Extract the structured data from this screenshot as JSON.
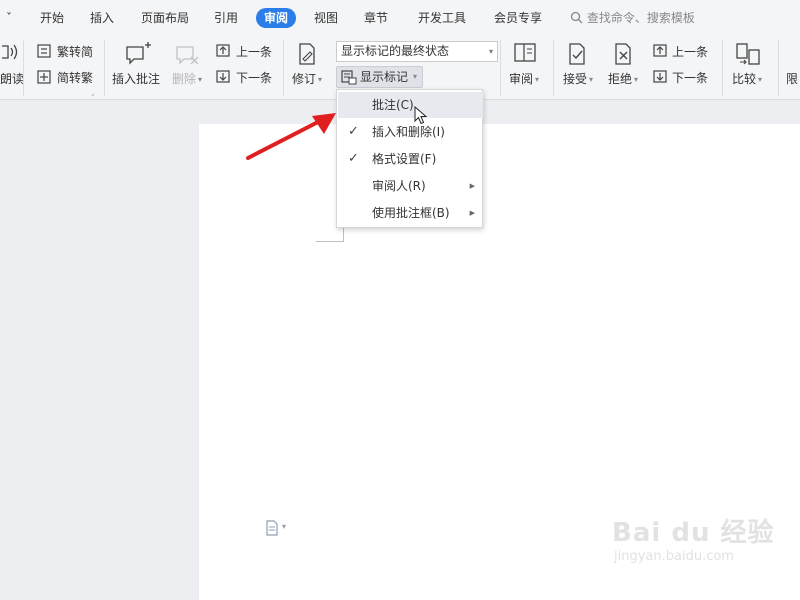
{
  "tabs": {
    "more_glyph": "ˇ",
    "items": [
      "开始",
      "插入",
      "页面布局",
      "引用",
      "审阅",
      "视图",
      "章节",
      "开发工具",
      "会员专享"
    ],
    "search_placeholder": "查找命令、搜索模板"
  },
  "ribbon": {
    "read_label": "朗读",
    "trad_to_simp": "繁转简",
    "simp_to_trad": "简转繁",
    "insert_comment": "插入批注",
    "delete": "删除",
    "prev_item": "上一条",
    "next_item": "下一条",
    "track_changes": "修订",
    "markup_combo": "显示标记的最终状态",
    "show_markup": "显示标记",
    "review": "审阅",
    "accept": "接受",
    "reject": "拒绝",
    "prev_change": "上一条",
    "next_change": "下一条",
    "compare": "比较",
    "restrict": "限"
  },
  "menu": {
    "items": [
      {
        "label": "批注(C)",
        "checked": false,
        "submenu": false,
        "highlighted": true
      },
      {
        "label": "插入和删除(I)",
        "checked": true,
        "submenu": false,
        "highlighted": false
      },
      {
        "label": "格式设置(F)",
        "checked": true,
        "submenu": false,
        "highlighted": false
      },
      {
        "label": "审阅人(R)",
        "checked": false,
        "submenu": true,
        "highlighted": false
      },
      {
        "label": "使用批注框(B)",
        "checked": false,
        "submenu": true,
        "highlighted": false
      }
    ]
  },
  "watermark": {
    "brand": "Bai du 经验",
    "url": "jingyan.baidu.com"
  },
  "colors": {
    "accent": "#2b7de9",
    "arrow": "#e02020"
  }
}
